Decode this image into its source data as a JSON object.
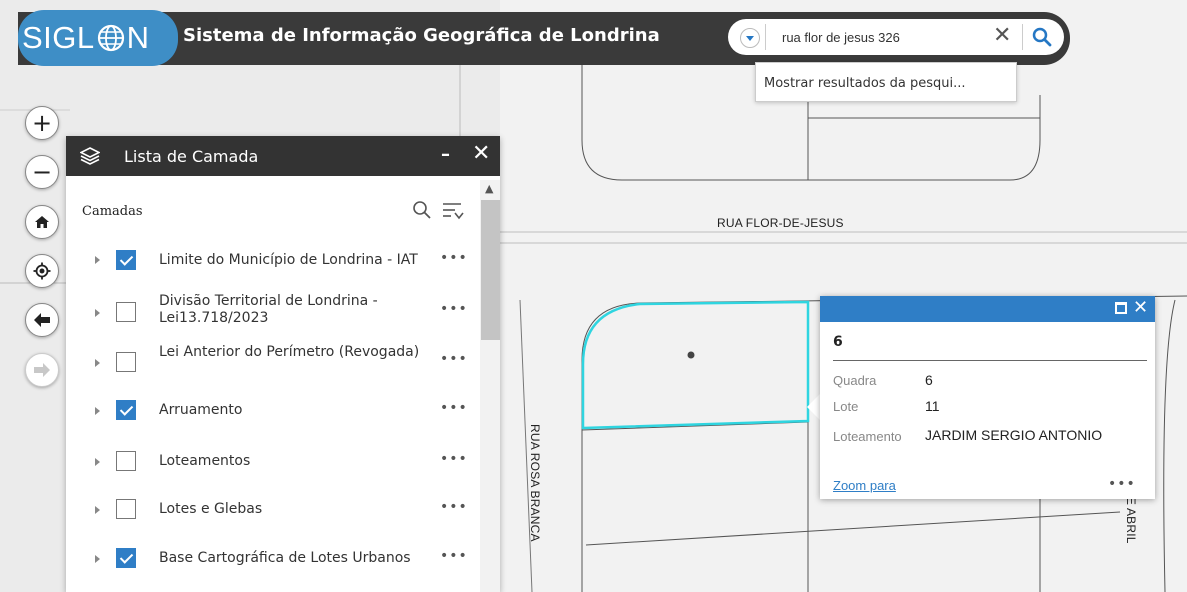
{
  "header": {
    "logo_text_left": "SIGL",
    "logo_text_right": "N",
    "title": "Sistema de Informação Geográfica de Londrina"
  },
  "search": {
    "value": "rua flor de jesus 326",
    "clear_icon": "close-icon",
    "search_icon": "search-icon",
    "suggestion": "Mostrar resultados da pesqui..."
  },
  "map": {
    "street_labels": {
      "flor": "RUA FLOR-DE-JESUS",
      "rosa": "RUA ROSA BRANCA",
      "abril": "DE ABRIL"
    }
  },
  "tools": {
    "zoom_in": "+",
    "zoom_out": "−",
    "forward": "➡"
  },
  "layer_panel": {
    "title": "Lista de Camada",
    "section_label": "Camadas",
    "more": "•••",
    "layers": [
      {
        "label": "Limite do Município de Londrina - IAT",
        "checked": true
      },
      {
        "label": "Divisão Territorial de Londrina - Lei13.718/2023",
        "checked": false
      },
      {
        "label": "Lei Anterior do Perímetro (Revogada)",
        "checked": false
      },
      {
        "label": "Arruamento",
        "checked": true
      },
      {
        "label": "Loteamentos",
        "checked": false
      },
      {
        "label": "Lotes e Glebas",
        "checked": false
      },
      {
        "label": "Base Cartográfica de Lotes Urbanos",
        "checked": true
      }
    ]
  },
  "popup": {
    "title": "6",
    "fields": [
      {
        "key": "Quadra",
        "value": "6"
      },
      {
        "key": "Lote",
        "value": "11"
      },
      {
        "key": "Loteamento",
        "value": "JARDIM SERGIO ANTONIO"
      }
    ],
    "zoom_link": "Zoom para",
    "more": "•••"
  },
  "colors": {
    "brand_blue": "#3e8ec6",
    "header_dark": "#3a3a3a",
    "selection_cyan": "#2fd5e0",
    "popup_blue": "#2f7ec6"
  }
}
